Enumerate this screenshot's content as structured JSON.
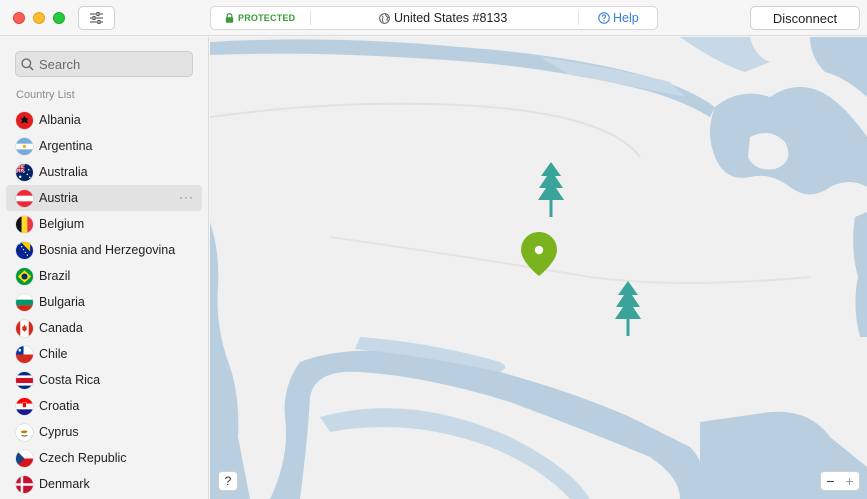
{
  "toolbar": {
    "status": "PROTECTED",
    "server": "United States #8133",
    "help": "Help",
    "disconnect": "Disconnect"
  },
  "sidebar": {
    "search_placeholder": "Search",
    "list_title": "Country List",
    "countries": [
      {
        "name": "Albania",
        "flag": "albania-flag-icon"
      },
      {
        "name": "Argentina",
        "flag": "argentina-flag-icon"
      },
      {
        "name": "Australia",
        "flag": "australia-flag-icon"
      },
      {
        "name": "Austria",
        "flag": "austria-flag-icon",
        "selected": true,
        "more": "···"
      },
      {
        "name": "Belgium",
        "flag": "belgium-flag-icon"
      },
      {
        "name": "Bosnia and Herzegovina",
        "flag": "bosnia-flag-icon"
      },
      {
        "name": "Brazil",
        "flag": "brazil-flag-icon"
      },
      {
        "name": "Bulgaria",
        "flag": "bulgaria-flag-icon"
      },
      {
        "name": "Canada",
        "flag": "canada-flag-icon"
      },
      {
        "name": "Chile",
        "flag": "chile-flag-icon"
      },
      {
        "name": "Costa Rica",
        "flag": "costa-rica-flag-icon"
      },
      {
        "name": "Croatia",
        "flag": "croatia-flag-icon"
      },
      {
        "name": "Cyprus",
        "flag": "cyprus-flag-icon"
      },
      {
        "name": "Czech Republic",
        "flag": "czech-flag-icon"
      },
      {
        "name": "Denmark",
        "flag": "denmark-flag-icon"
      }
    ]
  },
  "map": {
    "help": "?",
    "zoom_out": "−",
    "zoom_in": "+"
  },
  "colors": {
    "protected": "#3a9b3a",
    "link": "#3b7ed8",
    "water": "#b9cfe0",
    "land": "#f0f0f0",
    "tree": "#3aa39a",
    "pin": "#7bb31f"
  }
}
